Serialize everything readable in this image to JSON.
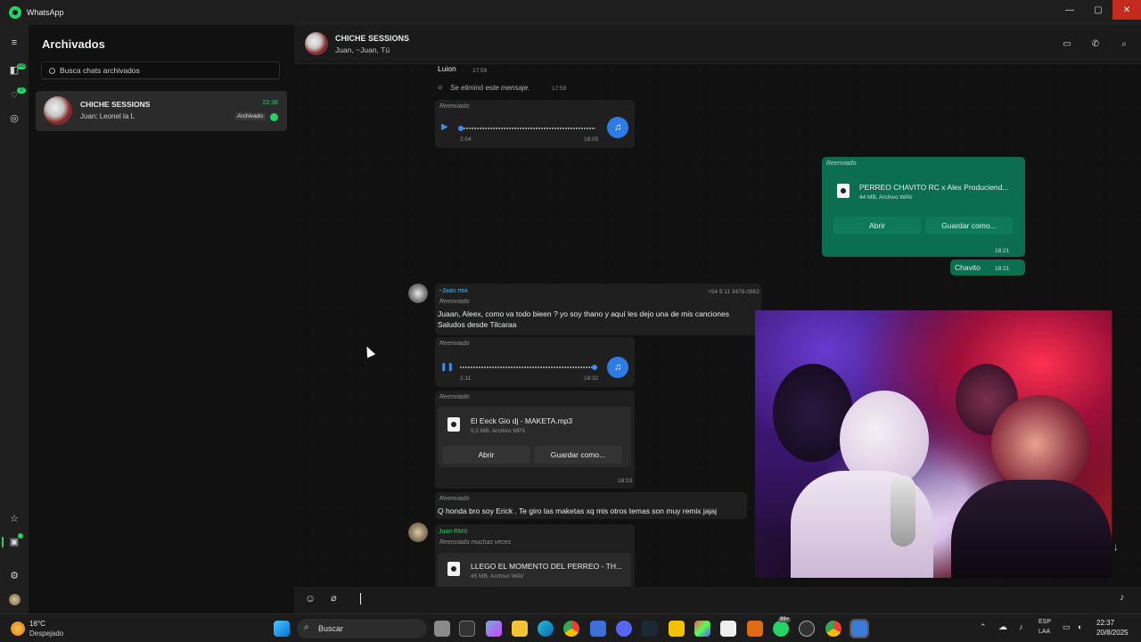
{
  "window": {
    "title": "WhatsApp",
    "minimize": "—",
    "maximize": "▢",
    "close": "✕"
  },
  "rail": {
    "badge_chats": "315",
    "badge_status": "2"
  },
  "list": {
    "title": "Archivados",
    "search_placeholder": "Busca chats archivados",
    "chat": {
      "name": "CHICHE SESSIONS",
      "time": "22:36",
      "preview": "Juan: Leonel la L",
      "chip": "Archivado"
    }
  },
  "header": {
    "name": "CHICHE SESSIONS",
    "subtitle": "Juan, ~Juan, Tú"
  },
  "messages": {
    "m1": {
      "text": "Luion",
      "time": "17:59"
    },
    "m2": {
      "text": "Se eliminó este mensaje.",
      "time": "17:59"
    },
    "m3": {
      "fwd": "Reenviado",
      "elapsed": "2:04",
      "time": "18:05"
    },
    "m4": {
      "fwd": "Reenviado",
      "file": "PERREO CHAVITO RC x Alex Produciend...",
      "meta": "44 MB, Archivo WAV",
      "open": "Abrir",
      "save": "Guardar como...",
      "time": "18:21"
    },
    "m5": {
      "text": "Chavito",
      "time": "18:21"
    },
    "m6": {
      "sender": "~Juan rmx",
      "phone": "+54 9 11 3476-0862",
      "fwd": "Reenviado",
      "line1": "Juaan, Aleex, como va todo bieen ? yo soy thano y aquí les dejo una de mis canciones",
      "line2": "Saludos desde Tilcaraa",
      "time": "18:32"
    },
    "m7": {
      "fwd": "Reenviado",
      "elapsed": "1:11",
      "time": "18:32"
    },
    "m8": {
      "fwd": "Reenviado",
      "file": "El Eeck  Gio dj - MAKETA.mp3",
      "meta": "5,0 MB, Archivo MP3",
      "open": "Abrir",
      "save": "Guardar como...",
      "time": "18:33"
    },
    "m9": {
      "fwd": "Reenviado",
      "text": "Q honda bro  soy Erick . Te giro las maketas xq mis otros temas son muy remix jajaj"
    },
    "m10": {
      "sender": "Juan RMX",
      "fwd": "Reenviado muchas veces",
      "file": "LLEGO EL MOMENTO DEL PERREO - TH...",
      "meta": "45 MB, Archivo WAV"
    }
  },
  "taskbar": {
    "weather_temp": "16°C",
    "weather_desc": "Despejado",
    "search": "Buscar",
    "lang1": "ESP",
    "lang2": "LAA",
    "time": "22:37",
    "date": "20/8/2025",
    "badge": "99+"
  },
  "colors": {
    "accent": "#25d366",
    "outgoing": "#0b6e4f",
    "incoming": "#1f1f1f",
    "music": "#2d7be5"
  }
}
